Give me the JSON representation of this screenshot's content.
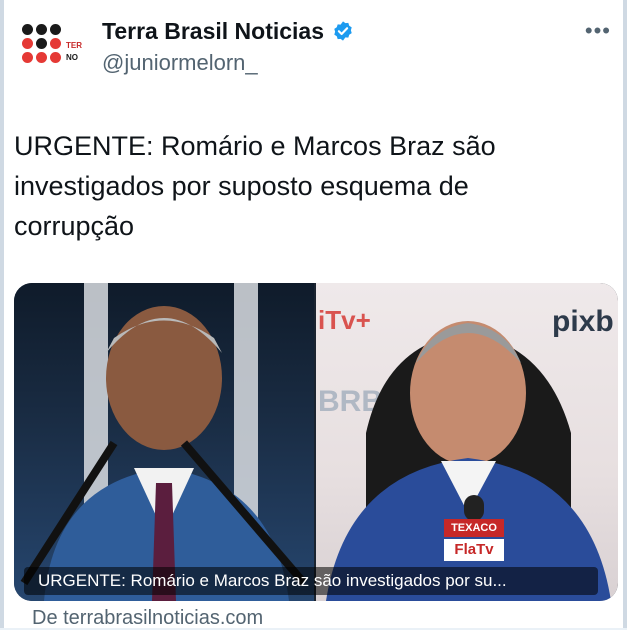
{
  "header": {
    "display_name": "Terra Brasil Noticias",
    "handle": "@juniormelorn_",
    "more_label": "•••"
  },
  "avatar": {
    "brand_text_1": "TER",
    "brand_text_2": "NO"
  },
  "tweet": {
    "line_1": "URGENTE: Romário e Marcos Braz são",
    "line_2": "investigados por suposto esquema de",
    "line_3": "corrupção"
  },
  "media": {
    "sponsors": {
      "tv_plus": "iTv+",
      "pixbet": "pixb",
      "brb": "BRB",
      "texaco": "TEXACO",
      "flatv": "FlaTv"
    },
    "caption": "URGENTE: Romário e Marcos Braz são investigados por su..."
  },
  "card": {
    "source": "De terrabrasilnoticias.com"
  },
  "colors": {
    "verified": "#1d9bf0",
    "text": "#0f1419",
    "muted": "#536471",
    "brand_red": "#e53935",
    "brand_dark": "#1a1a1a"
  }
}
